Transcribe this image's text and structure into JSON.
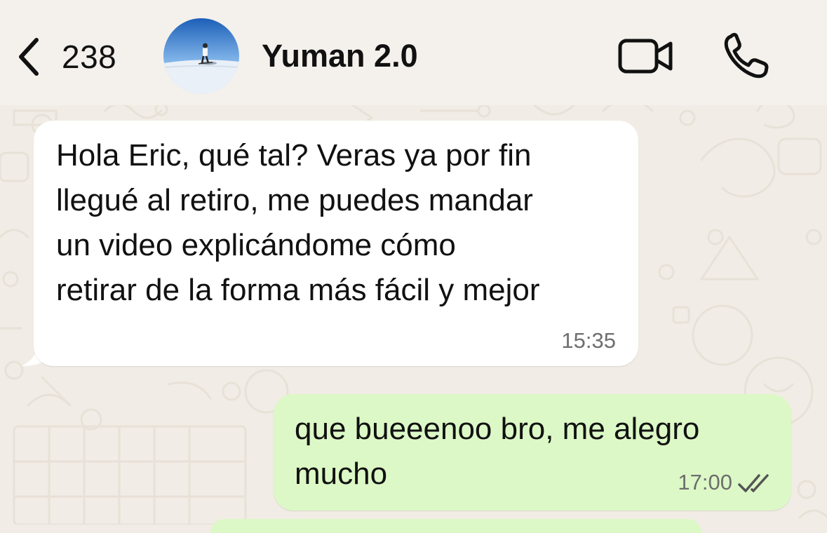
{
  "header": {
    "back_count": "238",
    "back_icon": "chevron-left-icon",
    "contact_name": "Yuman 2.0",
    "video_icon": "video-camera-icon",
    "call_icon": "phone-icon"
  },
  "messages": [
    {
      "direction": "incoming",
      "text": "Hola Eric, qué tal? Veras ya por fin\nllegué al retiro, me puedes mandar\nun video explicándome cómo\nretirar de la forma más fácil y mejor",
      "time": "15:35"
    },
    {
      "direction": "outgoing",
      "text": "que bueeenoo bro, me alegro\nmucho",
      "time": "17:00",
      "status_icon": "double-check-icon"
    }
  ],
  "colors": {
    "background": "#F1ECE5",
    "incoming_bubble": "#FFFFFF",
    "outgoing_bubble": "#DCF8C6",
    "time_text": "#6E6E6E"
  }
}
